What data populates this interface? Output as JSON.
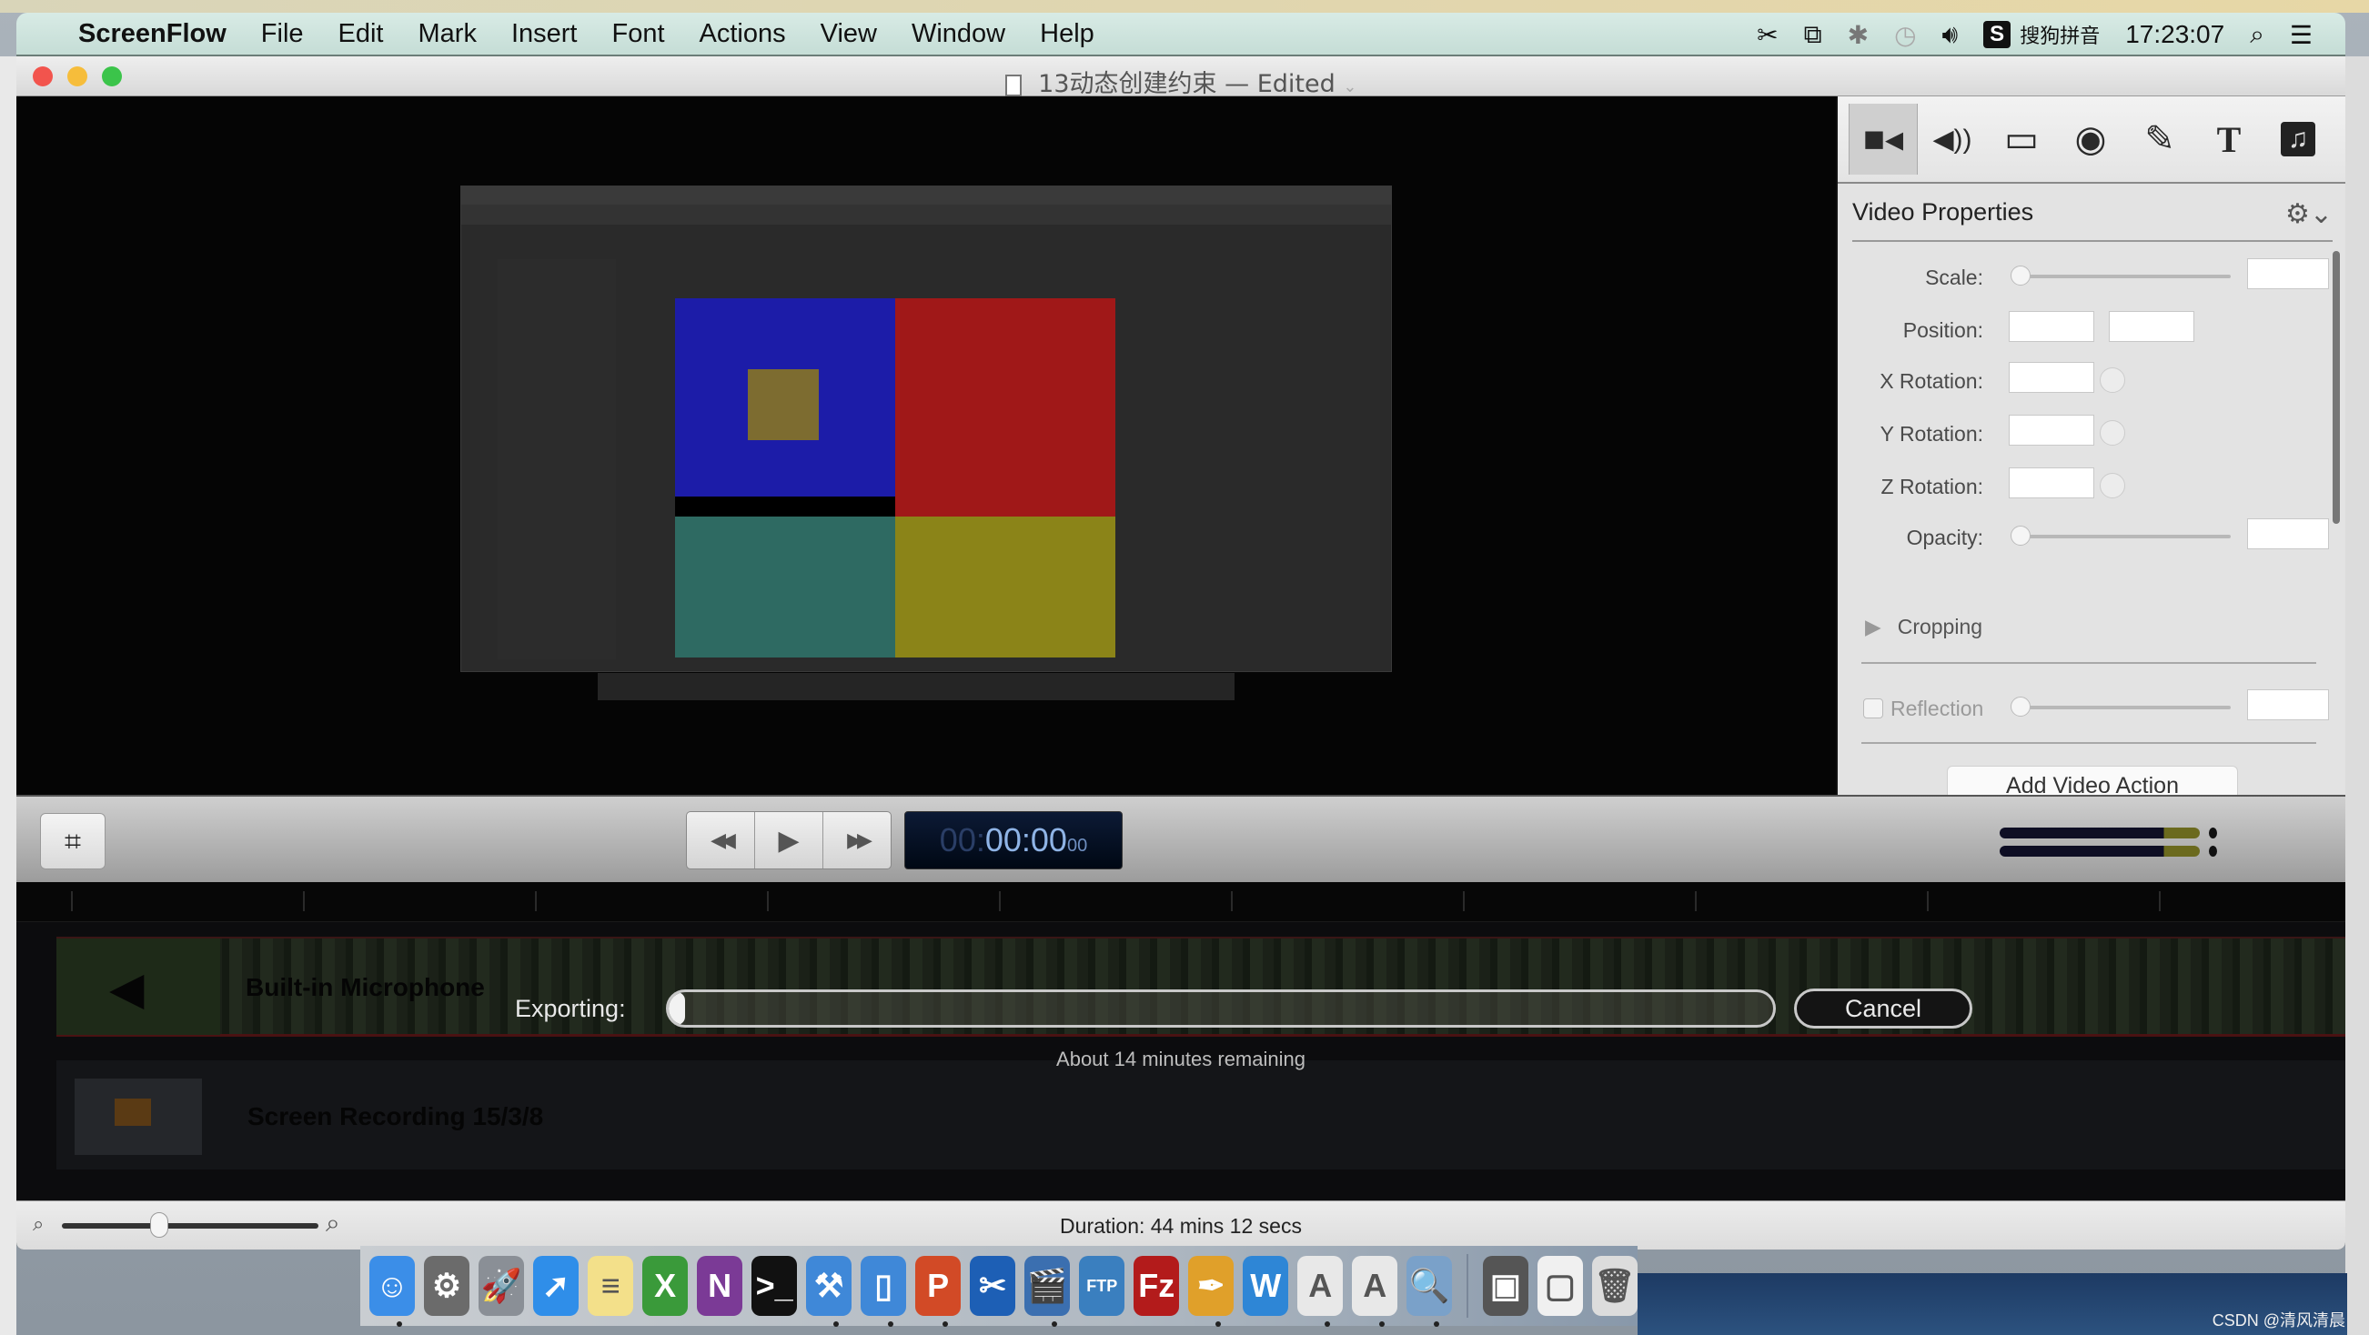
{
  "menubar": {
    "apple": "",
    "app_name": "ScreenFlow",
    "items": [
      "File",
      "Edit",
      "Mark",
      "Insert",
      "Font",
      "Actions",
      "View",
      "Window",
      "Help"
    ],
    "status_icons": [
      "scissors-icon",
      "screen-record-icon",
      "bluetooth-icon",
      "time-machine-icon",
      "volume-icon"
    ],
    "input_method_badge": "S",
    "input_method": "搜狗拼音",
    "clock": "17:23:07"
  },
  "window": {
    "title": "13动态创建约束",
    "separator": "—",
    "status": "Edited",
    "status_chevron": "⌄"
  },
  "inspector": {
    "tabs": [
      {
        "name": "video",
        "glyph": "■◂",
        "active": true
      },
      {
        "name": "audio",
        "glyph": "◀))",
        "active": false
      },
      {
        "name": "screen-recording",
        "glyph": "▭",
        "active": false
      },
      {
        "name": "callout",
        "glyph": "◉",
        "active": false
      },
      {
        "name": "annotations",
        "glyph": "✎",
        "active": false
      },
      {
        "name": "text",
        "glyph": "T",
        "active": false
      },
      {
        "name": "media-library",
        "glyph": "♫",
        "active": false
      }
    ],
    "header": "Video Properties",
    "gear": "⚙⌄",
    "labels": {
      "scale": "Scale:",
      "position": "Position:",
      "x_rotation": "X Rotation:",
      "y_rotation": "Y Rotation:",
      "z_rotation": "Z Rotation:",
      "opacity": "Opacity:",
      "cropping": "Cropping",
      "reflection": "Reflection"
    },
    "values": {
      "scale": "",
      "position_x": "",
      "position_y": "",
      "x_rotation": "",
      "y_rotation": "",
      "z_rotation": "",
      "opacity": "",
      "reflection": ""
    },
    "reflection_checked": false,
    "add_action_label": "Add Video Action"
  },
  "transport": {
    "crop_glyph": "⌗",
    "rewind": "◀◀",
    "play": "▶",
    "forward": "▶▶",
    "timecode_hours": "00",
    "timecode_main": "00:00",
    "timecode_frames": "00"
  },
  "timeline": {
    "tracks": [
      {
        "type": "audio",
        "name": "Built-in Microphone"
      },
      {
        "type": "video",
        "name": "Screen Recording 15/3/8"
      }
    ]
  },
  "export": {
    "label": "Exporting:",
    "progress_percent": 1,
    "cancel_label": "Cancel",
    "remaining": "About 14 minutes remaining"
  },
  "statusbar": {
    "duration": "Duration: 44 mins 12 secs",
    "zoom_level_fraction": 0.38
  },
  "dock": {
    "apps": [
      {
        "name": "finder",
        "glyph": "☺",
        "color": "#3b8ee8",
        "running": true
      },
      {
        "name": "system-preferences",
        "glyph": "⚙",
        "color": "#6b6b6b",
        "running": false
      },
      {
        "name": "launchpad",
        "glyph": "🚀",
        "color": "#8a8f96",
        "running": false
      },
      {
        "name": "safari",
        "glyph": "➚",
        "color": "#2f8ee9",
        "running": false
      },
      {
        "name": "notes",
        "glyph": "≡",
        "color": "#f3e08a",
        "running": false
      },
      {
        "name": "excel",
        "glyph": "X",
        "color": "#3a9a3a",
        "running": false
      },
      {
        "name": "onenote",
        "glyph": "N",
        "color": "#7b3a96",
        "running": false
      },
      {
        "name": "terminal",
        "glyph": ">_",
        "color": "#111111",
        "running": false
      },
      {
        "name": "xcode",
        "glyph": "⚒",
        "color": "#3f88d8",
        "running": true
      },
      {
        "name": "simulator",
        "glyph": "▯",
        "color": "#3f88d8",
        "running": true
      },
      {
        "name": "powerpoint",
        "glyph": "P",
        "color": "#d24a26",
        "running": true
      },
      {
        "name": "screenshot-tool",
        "glyph": "✂",
        "color": "#1d5fb5",
        "running": false
      },
      {
        "name": "screenflow",
        "glyph": "🎬",
        "color": "#3b6fb0",
        "running": true
      },
      {
        "name": "ftp-client",
        "glyph": "FTP",
        "color": "#3a7fbf",
        "running": false
      },
      {
        "name": "filezilla",
        "glyph": "Fz",
        "color": "#b31b1b",
        "running": false
      },
      {
        "name": "pen-tool",
        "glyph": "✒",
        "color": "#e0a02a",
        "running": true
      },
      {
        "name": "word",
        "glyph": "W",
        "color": "#2e86d6",
        "running": false
      },
      {
        "name": "text-editor-1",
        "glyph": "A",
        "color": "#e8e8e8",
        "running": true
      },
      {
        "name": "text-editor-2",
        "glyph": "A",
        "color": "#e8e8e8",
        "running": true
      },
      {
        "name": "preview",
        "glyph": "🔍",
        "color": "#7aa1c9",
        "running": true
      }
    ],
    "minimized": [
      {
        "name": "minimized-window-1",
        "glyph": "▣",
        "color": "#555555"
      },
      {
        "name": "minimized-window-2",
        "glyph": "▢",
        "color": "#f0f0f0"
      }
    ],
    "trash": {
      "name": "trash",
      "glyph": "🗑",
      "color": "#dcdcdc"
    }
  },
  "watermark": "CSDN @清风清晨"
}
